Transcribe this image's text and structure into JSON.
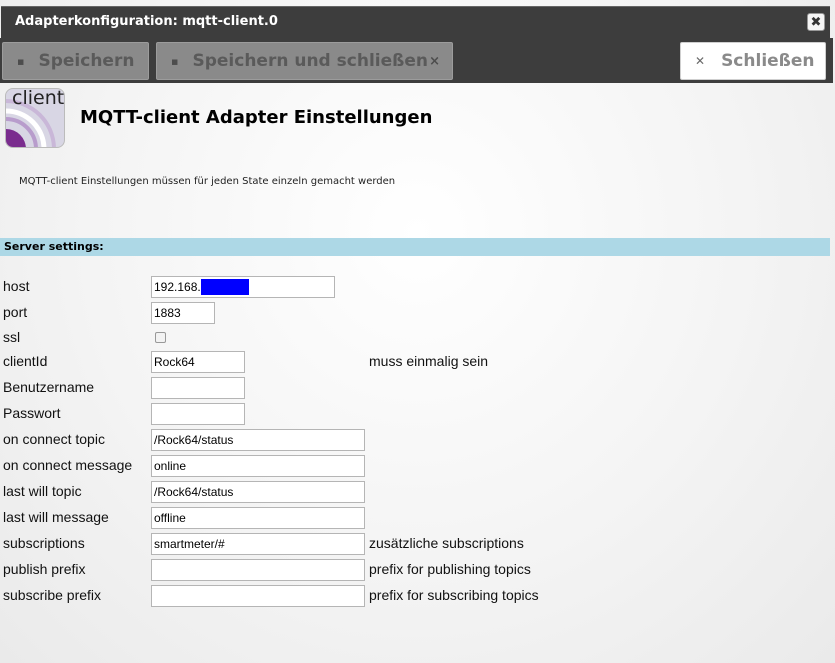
{
  "window": {
    "title": "Adapterkonfiguration: mqtt-client.0",
    "close_glyph": "✖"
  },
  "toolbar": {
    "save_label": "Speichern",
    "save_close_label": "Speichern und schließen",
    "close_label": "Schließen",
    "save_icon": "floppy-icon",
    "close_icon": "x-icon"
  },
  "header": {
    "logo_text": "client",
    "title": "MQTT-client Adapter Einstellungen",
    "note": "MQTT-client Einstellungen müssen für jeden State einzeln gemacht werden"
  },
  "section": {
    "title": "Server settings:"
  },
  "fields": {
    "host": {
      "label": "host",
      "value": "192.168."
    },
    "port": {
      "label": "port",
      "value": "1883"
    },
    "ssl": {
      "label": "ssl",
      "checked": false
    },
    "clientId": {
      "label": "clientId",
      "value": "Rock64",
      "note": "muss einmalig sein"
    },
    "username": {
      "label": "Benutzername",
      "value": ""
    },
    "password": {
      "label": "Passwort",
      "value": ""
    },
    "connect_topic": {
      "label": "on connect topic",
      "value": "/Rock64/status"
    },
    "connect_message": {
      "label": "on connect message",
      "value": "online"
    },
    "lastwill_topic": {
      "label": "last will topic",
      "value": "/Rock64/status"
    },
    "lastwill_message": {
      "label": "last will message",
      "value": "offline"
    },
    "subscriptions": {
      "label": "subscriptions",
      "value": "smartmeter/#",
      "note": "zusätzliche subscriptions"
    },
    "publish_prefix": {
      "label": "publish prefix",
      "value": "",
      "note": "prefix for publishing topics"
    },
    "subscribe_prefix": {
      "label": "subscribe prefix",
      "value": "",
      "note": "prefix for subscribing topics"
    }
  },
  "colors": {
    "section_bar": "#add8e6",
    "redaction": "#0000ff",
    "toolbar": "#3d3d3d"
  }
}
